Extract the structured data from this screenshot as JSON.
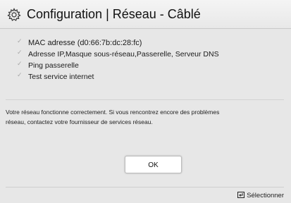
{
  "header": {
    "title": "Configuration | Réseau - Câblé",
    "icon": "gear-icon"
  },
  "checklist": {
    "items": [
      {
        "label": "MAC adresse (d0:66:7b:dc:28:fc)",
        "icon": "check-icon"
      },
      {
        "label": "Adresse IP,Masque sous-réseau,Passerelle, Serveur DNS",
        "icon": "check-icon"
      },
      {
        "label": "Ping passerelle",
        "icon": "check-icon"
      },
      {
        "label": "Test service internet",
        "icon": "check-icon"
      }
    ]
  },
  "message": {
    "line1": "Votre réseau fonctionne correctement. Si vous rencontrez encore des problèmes",
    "line2": "réseau, contactez votre fournisseur de services réseau."
  },
  "dialog": {
    "ok_label": "OK"
  },
  "footer": {
    "select_label": "Sélectionner",
    "icon": "enter-icon"
  },
  "colors": {
    "background": "#e7e7e7",
    "button_background": "#ffffff",
    "check": "#a8a8a8"
  }
}
